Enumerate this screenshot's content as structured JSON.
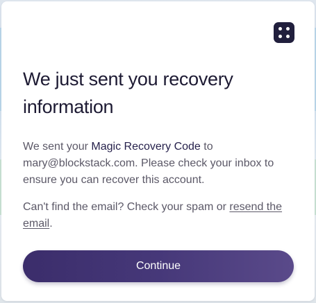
{
  "dialog": {
    "title": "We just sent you recovery information",
    "body": {
      "intro": "We sent your ",
      "highlight": "Magic Recovery Code",
      "after_highlight": " to mary@blockstack.com. Please check your inbox to ensure you can recover this account."
    },
    "help": {
      "text": "Can't find the email? Check your spam or ",
      "link_label": "resend the email",
      "suffix": "."
    },
    "continue_label": "Continue"
  },
  "icons": {
    "app_logo": "blockstack-logo-icon"
  },
  "colors": {
    "brand_dark": "#211f3d",
    "button_start": "#3b2d6b",
    "button_end": "#5a4a8a",
    "title": "#1d1a33",
    "body_text": "#5b5867"
  }
}
